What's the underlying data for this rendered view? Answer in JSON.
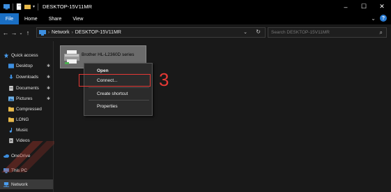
{
  "window": {
    "title": "DESKTOP-15V11MR",
    "controls": {
      "minimize": "–",
      "maximize": "☐",
      "close": "✕"
    }
  },
  "ribbon": {
    "tabs": [
      "File",
      "Home",
      "Share",
      "View"
    ],
    "expand_glyph": "⌄",
    "help_glyph": "?"
  },
  "navigation": {
    "back": "←",
    "forward": "→",
    "recent": "⌄",
    "up": "↑"
  },
  "address": {
    "crumbs": [
      "Network",
      "DESKTOP-15V11MR"
    ],
    "separator": "›",
    "dropdown_glyph": "⌄",
    "refresh_glyph": "↻"
  },
  "search": {
    "placeholder": "Search DESKTOP-15V11MR",
    "icon_glyph": "⌕"
  },
  "sidebar": {
    "pin_glyph": "✱",
    "items": [
      {
        "label": "Quick access",
        "icon": "star-icon",
        "color": "#4a9ef0"
      },
      {
        "label": "Desktop",
        "icon": "desktop-folder-icon",
        "color": "#3d8fe0",
        "pinned": true
      },
      {
        "label": "Downloads",
        "icon": "download-icon",
        "color": "#3d8fe0",
        "pinned": true
      },
      {
        "label": "Documents",
        "icon": "documents-icon",
        "color": "#cfcfcf",
        "pinned": true
      },
      {
        "label": "Pictures",
        "icon": "pictures-icon",
        "color": "#6fb2e8",
        "pinned": true
      },
      {
        "label": "Compressed",
        "icon": "folder-icon",
        "color": "#e8b94a"
      },
      {
        "label": "LONG",
        "icon": "folder-icon",
        "color": "#e8b94a"
      },
      {
        "label": "Music",
        "icon": "music-icon",
        "color": "#4a9ef0"
      },
      {
        "label": "Videos",
        "icon": "videos-icon",
        "color": "#bbbbbb"
      },
      {
        "label": "OneDrive",
        "icon": "cloud-icon",
        "color": "#3d8fe0"
      },
      {
        "label": "This PC",
        "icon": "computer-icon",
        "color": "#4a9ef0"
      },
      {
        "label": "Network",
        "icon": "network-icon",
        "color": "#4a9ef0",
        "selected": true
      }
    ]
  },
  "content": {
    "printer_name": "Brother HL-L2360D series"
  },
  "context_menu": {
    "items": [
      "Open",
      "Connect...",
      "Create shortcut",
      "Properties"
    ]
  },
  "annotation": {
    "step": "3",
    "color": "#e53935"
  }
}
